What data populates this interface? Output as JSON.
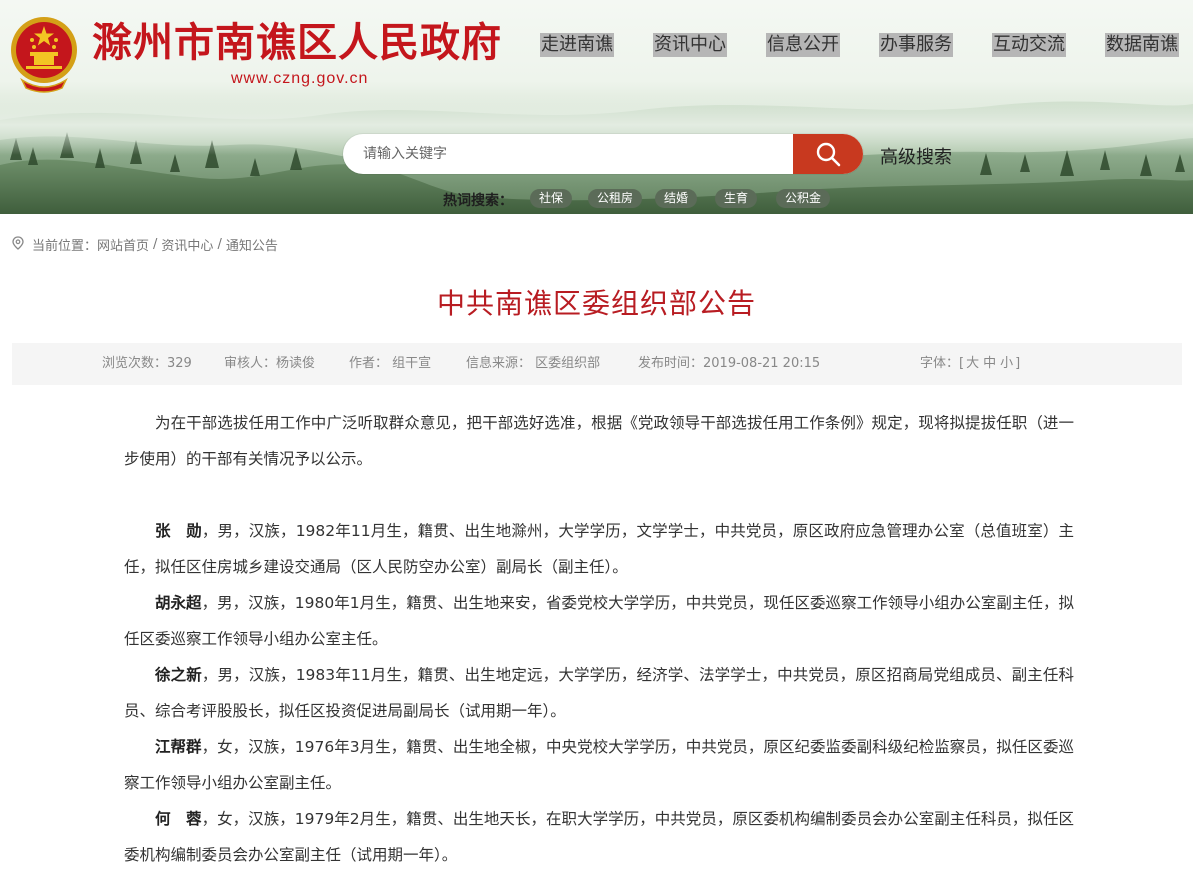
{
  "header": {
    "site_title": "滁州市南谯区人民政府",
    "site_url": "www.czng.gov.cn",
    "nav": [
      "走进南谯",
      "资讯中心",
      "信息公开",
      "办事服务",
      "互动交流",
      "数据南谯"
    ],
    "search_placeholder": "请输入关键字",
    "advanced_search": "高级搜索",
    "hot_label": "热词搜索：",
    "hot_tags": [
      "社保",
      "公租房",
      "结婚",
      "生育",
      "公积金"
    ],
    "colors": {
      "brand_red": "#c4161c",
      "search_button": "#c8391f",
      "nav_highlight": "#b6b6b6",
      "tag_bg": "#5b6b58"
    },
    "icons": [
      "national-emblem-icon",
      "search-icon"
    ]
  },
  "breadcrumb": {
    "prefix": "当前位置：",
    "items": [
      "网站首页",
      "资讯中心",
      "通知公告"
    ],
    "separator": "/",
    "icon": "location-pin-icon"
  },
  "article": {
    "title": "中共南谯区委组织部公告",
    "meta": {
      "views": "浏览次数：329",
      "reviewer": "审核人：杨读俊",
      "author": "作者：  组干宣",
      "source": "信息来源：  区委组织部",
      "published": "发布时间：2019-08-21 20:15",
      "font_label": "字体：[",
      "font_large": "大",
      "font_medium": "中",
      "font_small": "小",
      "font_end": "]"
    },
    "intro": "为在干部选拔任用工作中广泛听取群众意见，把干部选好选准，根据《党政领导干部选拔任用工作条例》规定，现将拟提拔任职（进一步使用）的干部有关情况予以公示。",
    "candidates": [
      {
        "name": "张　勋",
        "text": "，男，汉族，1982年11月生，籍贯、出生地滁州，大学学历，文学学士，中共党员，原区政府应急管理办公室（总值班室）主任，拟任区住房城乡建设交通局（区人民防空办公室）副局长（副主任）。"
      },
      {
        "name": "胡永超",
        "text": "，男，汉族，1980年1月生，籍贯、出生地来安，省委党校大学学历，中共党员，现任区委巡察工作领导小组办公室副主任，拟任区委巡察工作领导小组办公室主任。"
      },
      {
        "name": "徐之新",
        "text": "，男，汉族，1983年11月生，籍贯、出生地定远，大学学历，经济学、法学学士，中共党员，原区招商局党组成员、副主任科员、综合考评股股长，拟任区投资促进局副局长（试用期一年）。"
      },
      {
        "name": "江帮群",
        "text": "，女，汉族，1976年3月生，籍贯、出生地全椒，中央党校大学学历，中共党员，原区纪委监委副科级纪检监察员，拟任区委巡察工作领导小组办公室副主任。"
      },
      {
        "name": "何　蓉",
        "text": "，女，汉族，1979年2月生，籍贯、出生地天长，在职大学学历，中共党员，原区委机构编制委员会办公室副主任科员，拟任区委机构编制委员会办公室副主任（试用期一年）。"
      }
    ],
    "colors": {
      "title": "#b81c22",
      "meta_bg": "#f5f5f5"
    }
  }
}
